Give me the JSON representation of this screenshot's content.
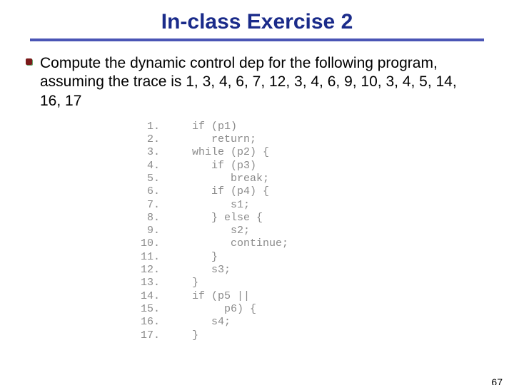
{
  "title": "In-class Exercise 2",
  "bullet": "Compute the dynamic control dep for the following program, assuming the trace is 1, 3, 4, 6, 7, 12, 3, 4, 6, 9, 10, 3, 4, 5, 14, 16, 17",
  "code": [
    {
      "n": "1.",
      "t": "   if (p1)"
    },
    {
      "n": "2.",
      "t": "      return;"
    },
    {
      "n": "3.",
      "t": "   while (p2) {"
    },
    {
      "n": "4.",
      "t": "      if (p3)"
    },
    {
      "n": "5.",
      "t": "         break;"
    },
    {
      "n": "6.",
      "t": "      if (p4) {"
    },
    {
      "n": "7.",
      "t": "         s1;"
    },
    {
      "n": "8.",
      "t": "      } else {"
    },
    {
      "n": "9.",
      "t": "         s2;"
    },
    {
      "n": "10.",
      "t": "         continue;"
    },
    {
      "n": "11.",
      "t": "      }"
    },
    {
      "n": "12.",
      "t": "      s3;"
    },
    {
      "n": "13.",
      "t": "   }"
    },
    {
      "n": "14.",
      "t": "   if (p5 ||"
    },
    {
      "n": "15.",
      "t": "        p6) {"
    },
    {
      "n": "16.",
      "t": "      s4;"
    },
    {
      "n": "17.",
      "t": "   }"
    }
  ],
  "page_number": "67"
}
